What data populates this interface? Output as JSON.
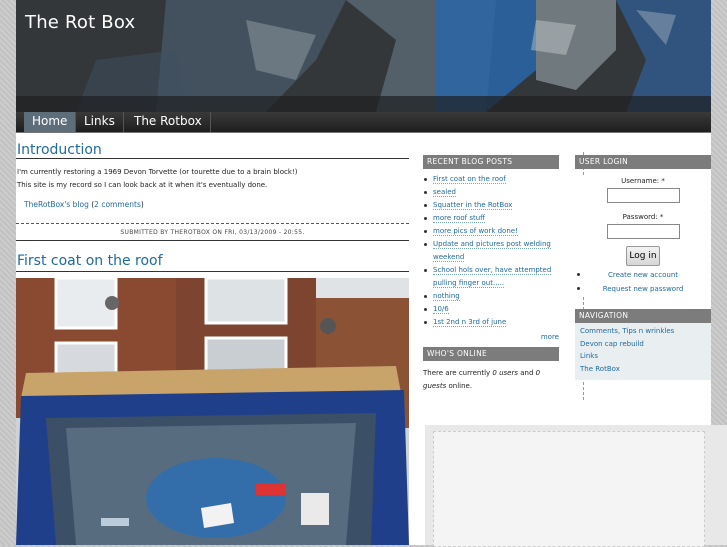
{
  "site": {
    "title": "The Rot Box"
  },
  "nav": {
    "items": [
      "Home",
      "Links",
      "The Rotbox"
    ]
  },
  "intro": {
    "title": "Introduction",
    "line1": "I'm currently restoring a 1969 Devon Torvette (or tourette due to a brain block!)",
    "line2": "This site is my record so I can look back at it when it's eventually done.",
    "blog_link": "TheRotBox's blog",
    "comments_open": "(",
    "comments_link": "2 comments",
    "comments_close": ")",
    "submitted": "SUBMITTED BY THEROTBOX ON FRI, 03/13/2009 - 20:55."
  },
  "post2": {
    "title": "First coat on the roof"
  },
  "recent": {
    "title": "RECENT BLOG POSTS",
    "items": [
      "First coat on the roof",
      "sealed",
      "Squatter in the RotBox",
      "more roof stuff",
      "more pics of work done!",
      "Update and pictures post welding",
      "weekend",
      "School hols over, have attempted",
      "pulling finger out.....",
      "nothing",
      "10/6",
      "1st 2nd n 3rd of june"
    ],
    "more": "more"
  },
  "online": {
    "title": "WHO'S ONLINE",
    "text1": "There are currently",
    "users": "0 users",
    "and": "and",
    "guests_num": "0",
    "guests": "guests",
    "tail": "online."
  },
  "login": {
    "title": "USER LOGIN",
    "username_label": "Username: *",
    "password_label": "Password: *",
    "button": "Log in",
    "create": "Create new account",
    "request": "Request new password"
  },
  "navigation": {
    "title": "NAVIGATION",
    "items": [
      "Comments, Tips n wrinkles",
      "Devon cap rebuild",
      "Links",
      "The RotBox"
    ]
  },
  "colors": {
    "link": "#1f6a9f",
    "block_header": "#7c7c7c",
    "nav_active": "#5d6d7a"
  }
}
